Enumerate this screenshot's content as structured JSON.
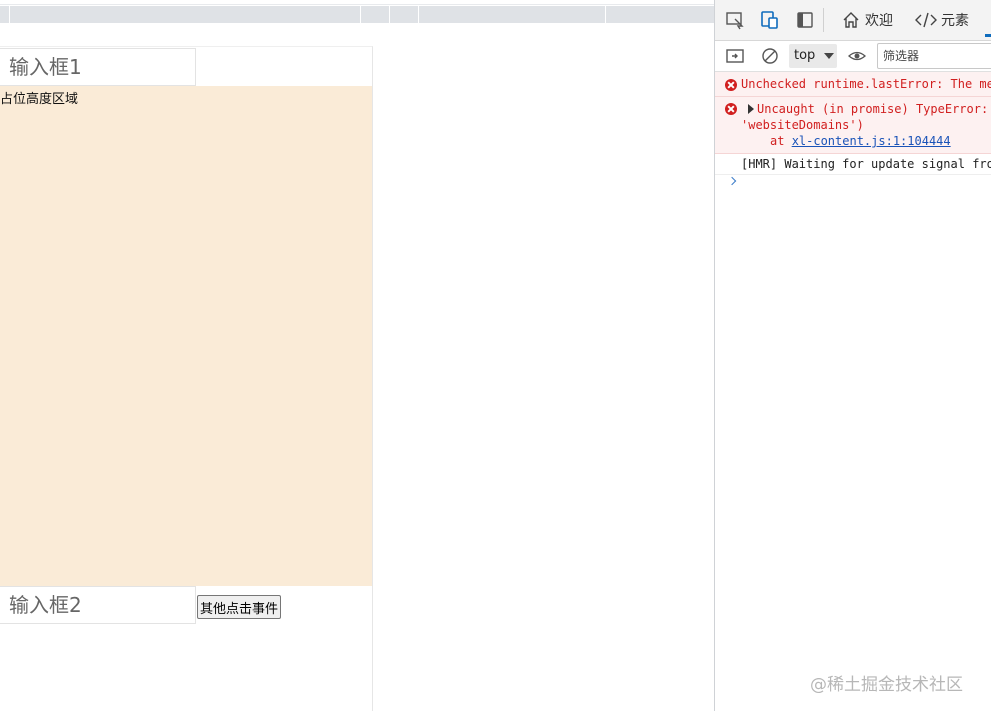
{
  "page": {
    "input_1_placeholder": "输入框1",
    "input_2_placeholder": "输入框2",
    "placeholder_area_label": "占位高度区域",
    "other_button_label": "其他点击事件"
  },
  "devtools": {
    "tabs": [
      {
        "label": "欢迎",
        "icon": "home-icon"
      },
      {
        "label": "元素",
        "icon": "code-icon"
      }
    ],
    "context_selector": "top",
    "filter_placeholder": "筛选器",
    "console_logs": [
      {
        "level": "error",
        "text": "Unchecked runtime.lastError: The me"
      },
      {
        "level": "error",
        "text": "Uncaught (in promise) TypeError:",
        "text2": "'websiteDomains')",
        "at_prefix": "at ",
        "link": "xl-content.js:1:104444"
      },
      {
        "level": "info",
        "text": "[HMR] Waiting for update signal fro"
      }
    ]
  },
  "watermark": "@稀土掘金技术社区",
  "colors": {
    "placeholder_area_bg": "#faebd7",
    "error_text": "#d11f1f",
    "active_tab": "#0f6cbd"
  }
}
